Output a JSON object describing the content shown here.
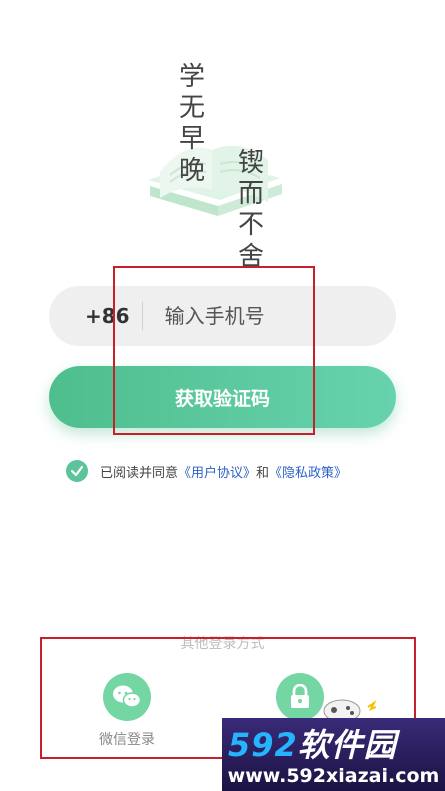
{
  "hero": {
    "line1": [
      "学",
      "无",
      "早",
      "晚"
    ],
    "line2": [
      "锲",
      "而",
      "不",
      "舍"
    ]
  },
  "login": {
    "country_code": "+86",
    "phone_placeholder": "输入手机号",
    "get_code_label": "获取验证码"
  },
  "agreement": {
    "prefix": "已阅读并同意",
    "user_agreement": "《用户协议》",
    "conj": "和",
    "privacy_policy": "《隐私政策》",
    "checked": true
  },
  "other_login": {
    "title": "其他登录方式",
    "options": [
      {
        "label": "微信登录",
        "icon": "wechat-icon"
      },
      {
        "label": "",
        "icon": "lock-icon"
      }
    ]
  },
  "watermark": {
    "brand_num": "592",
    "brand_text": "软件园",
    "url": "www.592xiazai.com"
  },
  "colors": {
    "accent": "#5cc49a",
    "link": "#2c62c8",
    "annotation": "#c8202a"
  }
}
